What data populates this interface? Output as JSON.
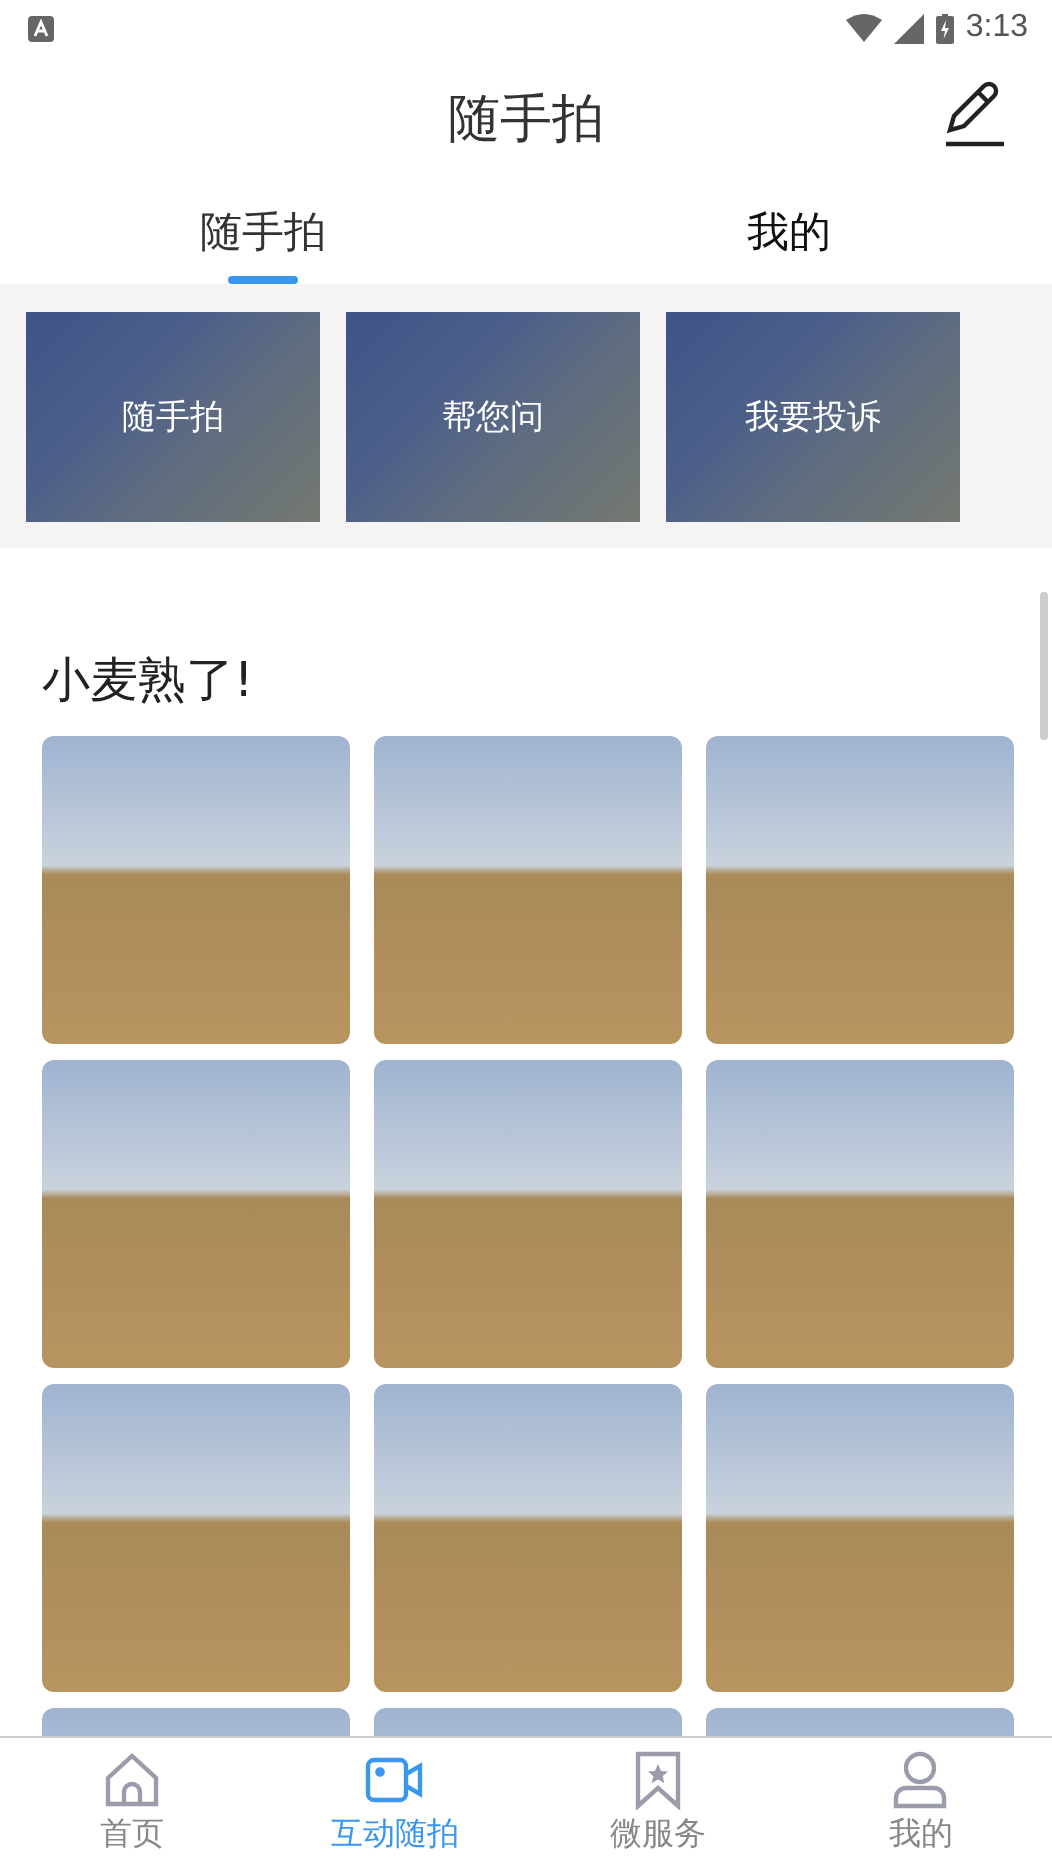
{
  "status_bar": {
    "time": "3:13"
  },
  "header": {
    "title": "随手拍"
  },
  "tabs": [
    {
      "label": "随手拍",
      "selected": true
    },
    {
      "label": "我的",
      "selected": false
    }
  ],
  "shortcuts": [
    "随手拍",
    "帮您问",
    "我要投诉"
  ],
  "album": {
    "title": "小麦熟了!"
  },
  "bottom_nav": [
    {
      "label": "首页",
      "selected": false
    },
    {
      "label": "互动随拍",
      "selected": true
    },
    {
      "label": "微服务",
      "selected": false
    },
    {
      "label": "我的",
      "selected": false
    }
  ]
}
